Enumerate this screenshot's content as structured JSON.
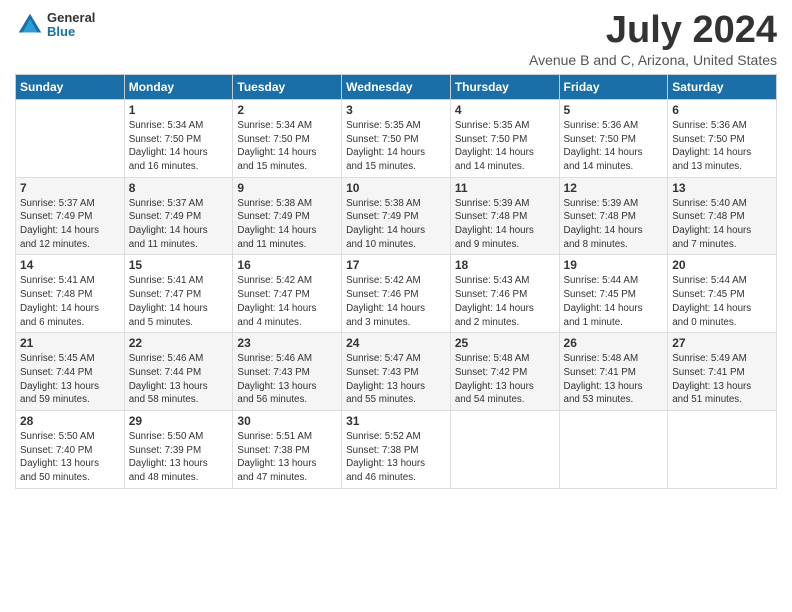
{
  "logo": {
    "general": "General",
    "blue": "Blue"
  },
  "title": "July 2024",
  "location": "Avenue B and C, Arizona, United States",
  "days": [
    "Sunday",
    "Monday",
    "Tuesday",
    "Wednesday",
    "Thursday",
    "Friday",
    "Saturday"
  ],
  "weeks": [
    [
      {
        "num": "",
        "info": ""
      },
      {
        "num": "1",
        "info": "Sunrise: 5:34 AM\nSunset: 7:50 PM\nDaylight: 14 hours\nand 16 minutes."
      },
      {
        "num": "2",
        "info": "Sunrise: 5:34 AM\nSunset: 7:50 PM\nDaylight: 14 hours\nand 15 minutes."
      },
      {
        "num": "3",
        "info": "Sunrise: 5:35 AM\nSunset: 7:50 PM\nDaylight: 14 hours\nand 15 minutes."
      },
      {
        "num": "4",
        "info": "Sunrise: 5:35 AM\nSunset: 7:50 PM\nDaylight: 14 hours\nand 14 minutes."
      },
      {
        "num": "5",
        "info": "Sunrise: 5:36 AM\nSunset: 7:50 PM\nDaylight: 14 hours\nand 14 minutes."
      },
      {
        "num": "6",
        "info": "Sunrise: 5:36 AM\nSunset: 7:50 PM\nDaylight: 14 hours\nand 13 minutes."
      }
    ],
    [
      {
        "num": "7",
        "info": "Sunrise: 5:37 AM\nSunset: 7:49 PM\nDaylight: 14 hours\nand 12 minutes."
      },
      {
        "num": "8",
        "info": "Sunrise: 5:37 AM\nSunset: 7:49 PM\nDaylight: 14 hours\nand 11 minutes."
      },
      {
        "num": "9",
        "info": "Sunrise: 5:38 AM\nSunset: 7:49 PM\nDaylight: 14 hours\nand 11 minutes."
      },
      {
        "num": "10",
        "info": "Sunrise: 5:38 AM\nSunset: 7:49 PM\nDaylight: 14 hours\nand 10 minutes."
      },
      {
        "num": "11",
        "info": "Sunrise: 5:39 AM\nSunset: 7:48 PM\nDaylight: 14 hours\nand 9 minutes."
      },
      {
        "num": "12",
        "info": "Sunrise: 5:39 AM\nSunset: 7:48 PM\nDaylight: 14 hours\nand 8 minutes."
      },
      {
        "num": "13",
        "info": "Sunrise: 5:40 AM\nSunset: 7:48 PM\nDaylight: 14 hours\nand 7 minutes."
      }
    ],
    [
      {
        "num": "14",
        "info": "Sunrise: 5:41 AM\nSunset: 7:48 PM\nDaylight: 14 hours\nand 6 minutes."
      },
      {
        "num": "15",
        "info": "Sunrise: 5:41 AM\nSunset: 7:47 PM\nDaylight: 14 hours\nand 5 minutes."
      },
      {
        "num": "16",
        "info": "Sunrise: 5:42 AM\nSunset: 7:47 PM\nDaylight: 14 hours\nand 4 minutes."
      },
      {
        "num": "17",
        "info": "Sunrise: 5:42 AM\nSunset: 7:46 PM\nDaylight: 14 hours\nand 3 minutes."
      },
      {
        "num": "18",
        "info": "Sunrise: 5:43 AM\nSunset: 7:46 PM\nDaylight: 14 hours\nand 2 minutes."
      },
      {
        "num": "19",
        "info": "Sunrise: 5:44 AM\nSunset: 7:45 PM\nDaylight: 14 hours\nand 1 minute."
      },
      {
        "num": "20",
        "info": "Sunrise: 5:44 AM\nSunset: 7:45 PM\nDaylight: 14 hours\nand 0 minutes."
      }
    ],
    [
      {
        "num": "21",
        "info": "Sunrise: 5:45 AM\nSunset: 7:44 PM\nDaylight: 13 hours\nand 59 minutes."
      },
      {
        "num": "22",
        "info": "Sunrise: 5:46 AM\nSunset: 7:44 PM\nDaylight: 13 hours\nand 58 minutes."
      },
      {
        "num": "23",
        "info": "Sunrise: 5:46 AM\nSunset: 7:43 PM\nDaylight: 13 hours\nand 56 minutes."
      },
      {
        "num": "24",
        "info": "Sunrise: 5:47 AM\nSunset: 7:43 PM\nDaylight: 13 hours\nand 55 minutes."
      },
      {
        "num": "25",
        "info": "Sunrise: 5:48 AM\nSunset: 7:42 PM\nDaylight: 13 hours\nand 54 minutes."
      },
      {
        "num": "26",
        "info": "Sunrise: 5:48 AM\nSunset: 7:41 PM\nDaylight: 13 hours\nand 53 minutes."
      },
      {
        "num": "27",
        "info": "Sunrise: 5:49 AM\nSunset: 7:41 PM\nDaylight: 13 hours\nand 51 minutes."
      }
    ],
    [
      {
        "num": "28",
        "info": "Sunrise: 5:50 AM\nSunset: 7:40 PM\nDaylight: 13 hours\nand 50 minutes."
      },
      {
        "num": "29",
        "info": "Sunrise: 5:50 AM\nSunset: 7:39 PM\nDaylight: 13 hours\nand 48 minutes."
      },
      {
        "num": "30",
        "info": "Sunrise: 5:51 AM\nSunset: 7:38 PM\nDaylight: 13 hours\nand 47 minutes."
      },
      {
        "num": "31",
        "info": "Sunrise: 5:52 AM\nSunset: 7:38 PM\nDaylight: 13 hours\nand 46 minutes."
      },
      {
        "num": "",
        "info": ""
      },
      {
        "num": "",
        "info": ""
      },
      {
        "num": "",
        "info": ""
      }
    ]
  ]
}
